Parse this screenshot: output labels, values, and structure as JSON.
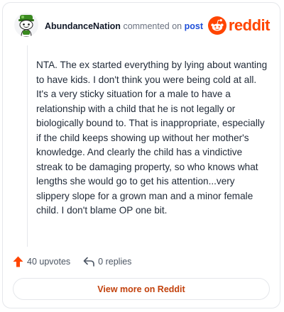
{
  "header": {
    "username": "AbundanceNation",
    "action_text": "commented on",
    "target_text": "post"
  },
  "brand": {
    "wordmark": "reddit",
    "icon": "reddit-logo-icon",
    "color": "#ff4500"
  },
  "avatar": {
    "icon": "snoo-avatar-icon",
    "accent_color": "#3a8a1f"
  },
  "comment": {
    "body": "NTA. The ex started everything by lying about wanting to have kids. I don't think you were being cold at all. It's a very sticky situation for a male to have a relationship with a child that he is not legally or biologically bound to. That is inappropriate, especially if the child keeps showing up without her mother's knowledge. And clearly the child has a vindictive streak to be damaging property, so who knows what lengths she would go to get his attention...very slippery slope for a grown man and a minor female child. I don't blame OP one bit."
  },
  "footer": {
    "upvotes_label": "40 upvotes",
    "upvote_icon": "upvote-arrow-icon",
    "upvote_color": "#ff4500",
    "replies_label": "0 replies",
    "reply_icon": "reply-arrow-icon"
  },
  "cta": {
    "label": "View more on Reddit",
    "color": "#c2410c"
  }
}
